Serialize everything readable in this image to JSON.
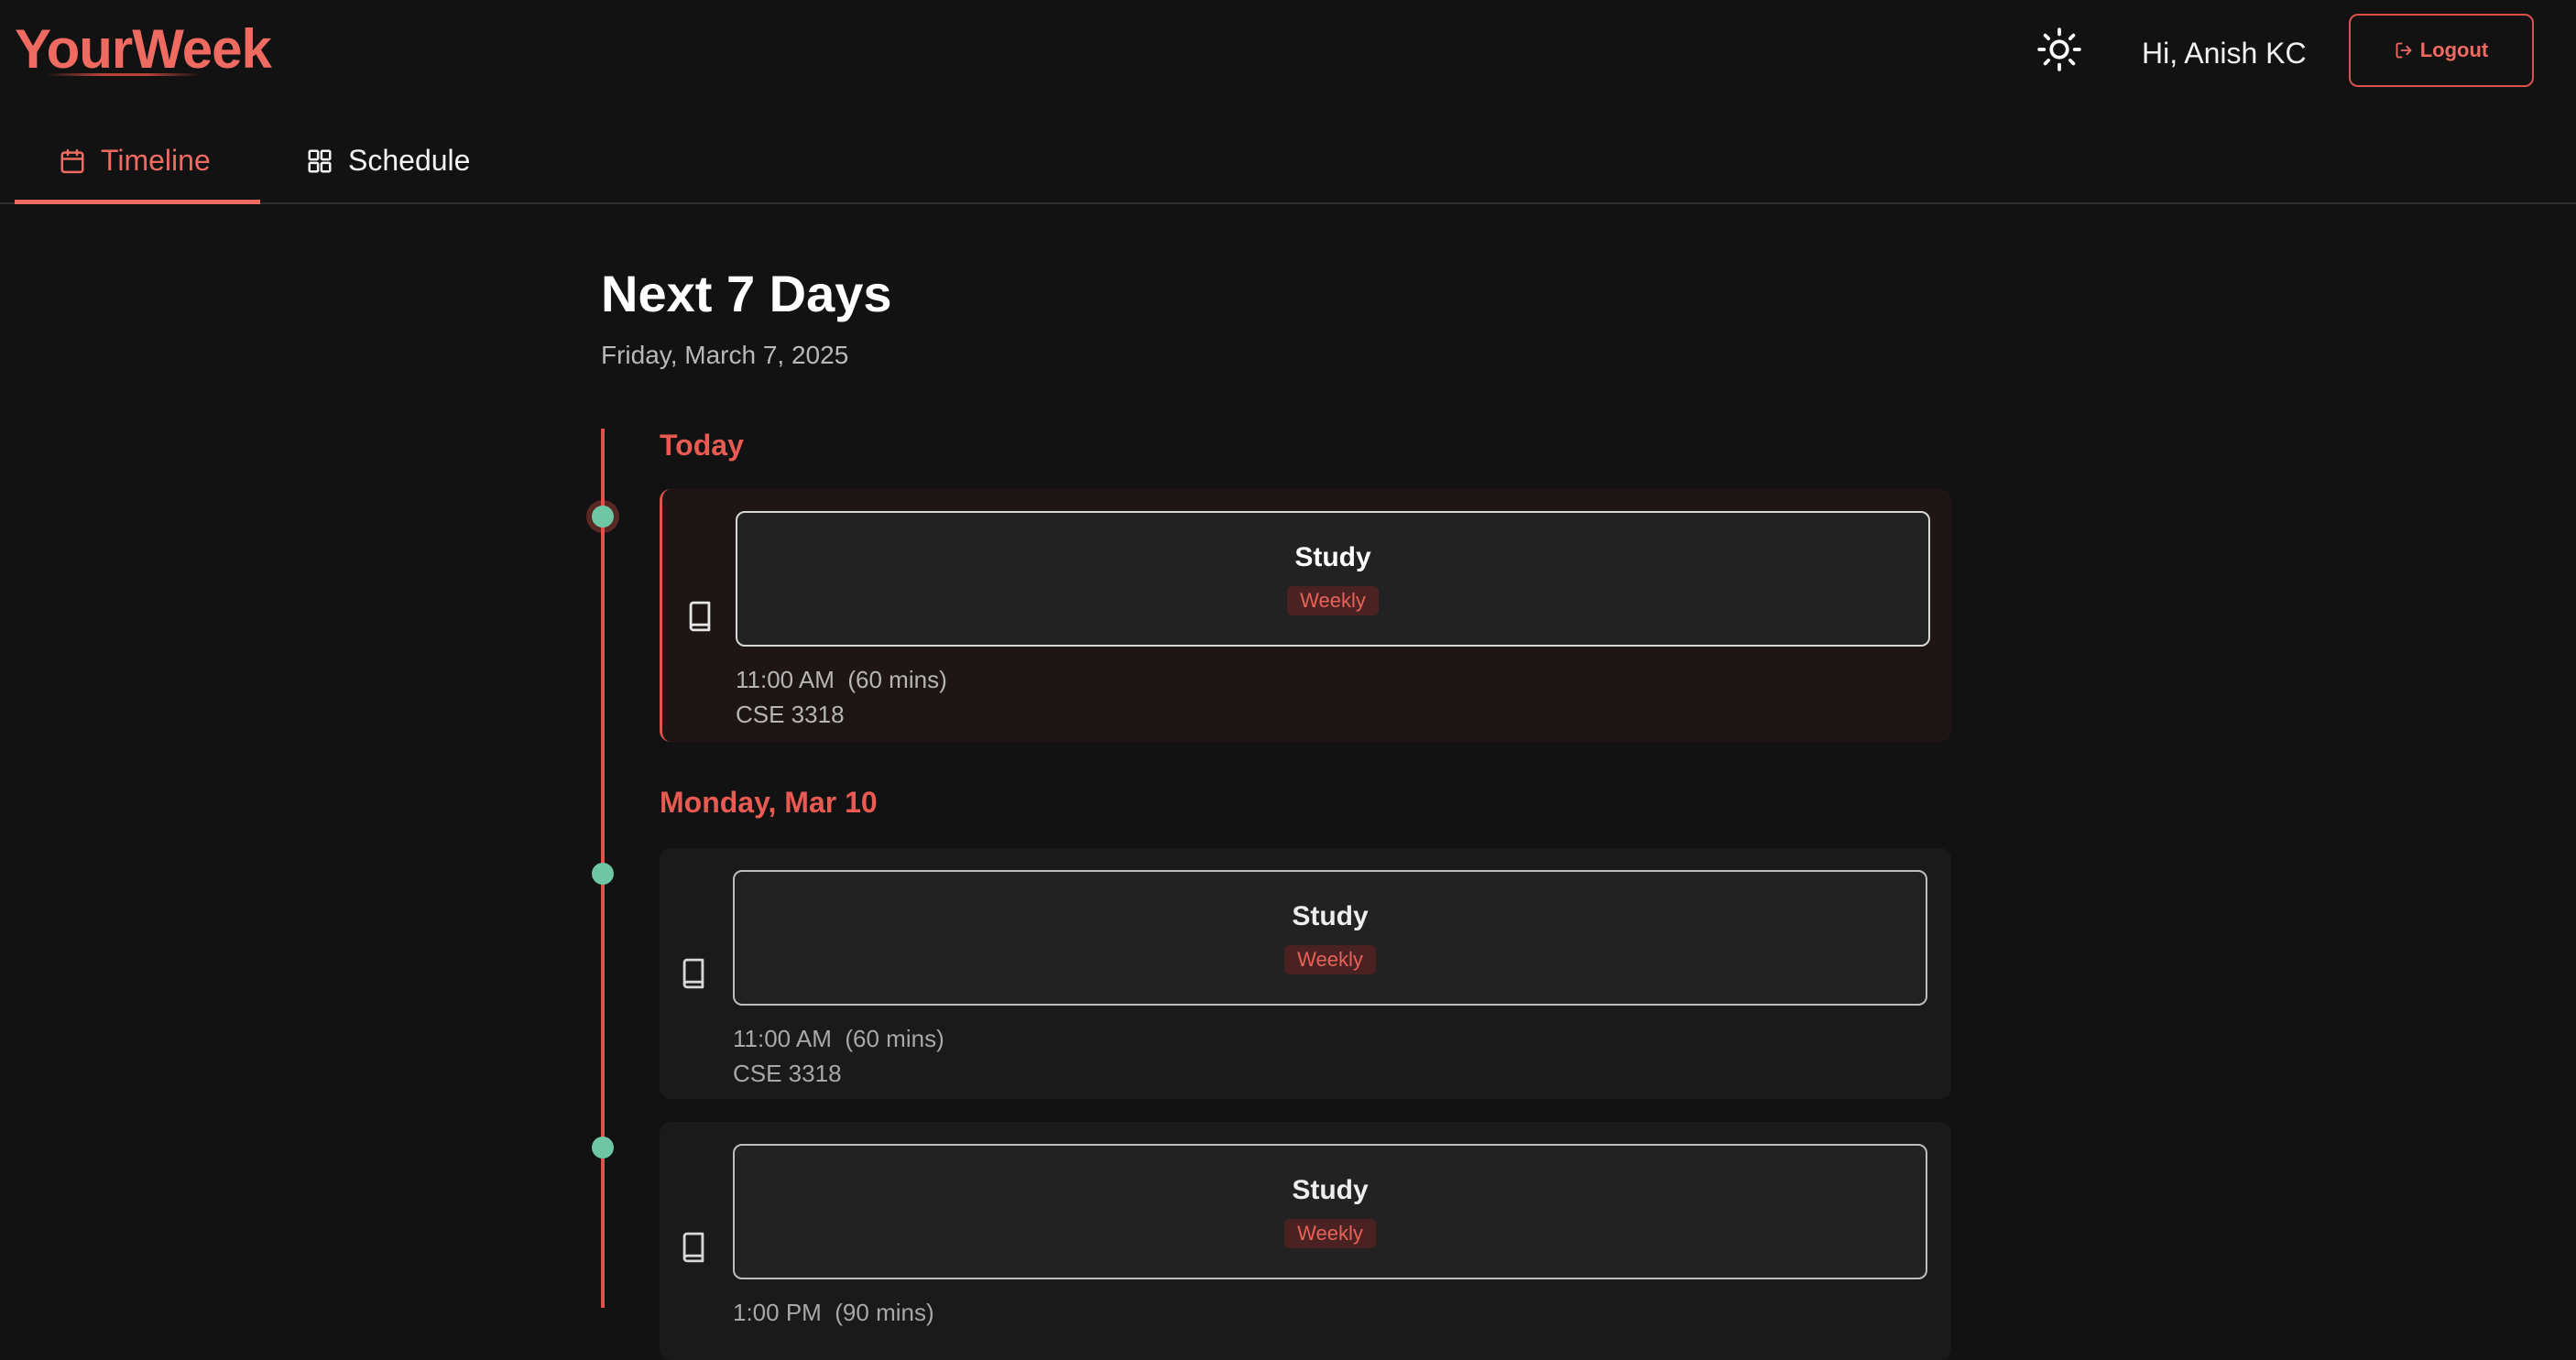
{
  "app": {
    "logo": "YourWeek",
    "greeting": "Hi, Anish KC",
    "logout_label": "Logout",
    "accent_color": "#ef6b62",
    "dot_color": "#6fc6a4"
  },
  "tabs": [
    {
      "label": "Timeline",
      "icon": "calendar-icon",
      "active": true
    },
    {
      "label": "Schedule",
      "icon": "grid-icon",
      "active": false
    }
  ],
  "main": {
    "title": "Next 7 Days",
    "date": "Friday, March 7, 2025"
  },
  "days": [
    {
      "label": "Today",
      "events": [
        {
          "title": "Study",
          "badge": "Weekly",
          "time": "11:00 AM  (60 mins)",
          "course": "CSE 3318",
          "icon": "book-icon",
          "highlighted": true
        }
      ]
    },
    {
      "label": "Monday, Mar 10",
      "events": [
        {
          "title": "Study",
          "badge": "Weekly",
          "time": "11:00 AM  (60 mins)",
          "course": "CSE 3318",
          "icon": "book-icon",
          "highlighted": false
        },
        {
          "title": "Study",
          "badge": "Weekly",
          "time": "1:00 PM  (90 mins)",
          "course": "",
          "icon": "book-icon",
          "highlighted": false
        }
      ]
    }
  ]
}
